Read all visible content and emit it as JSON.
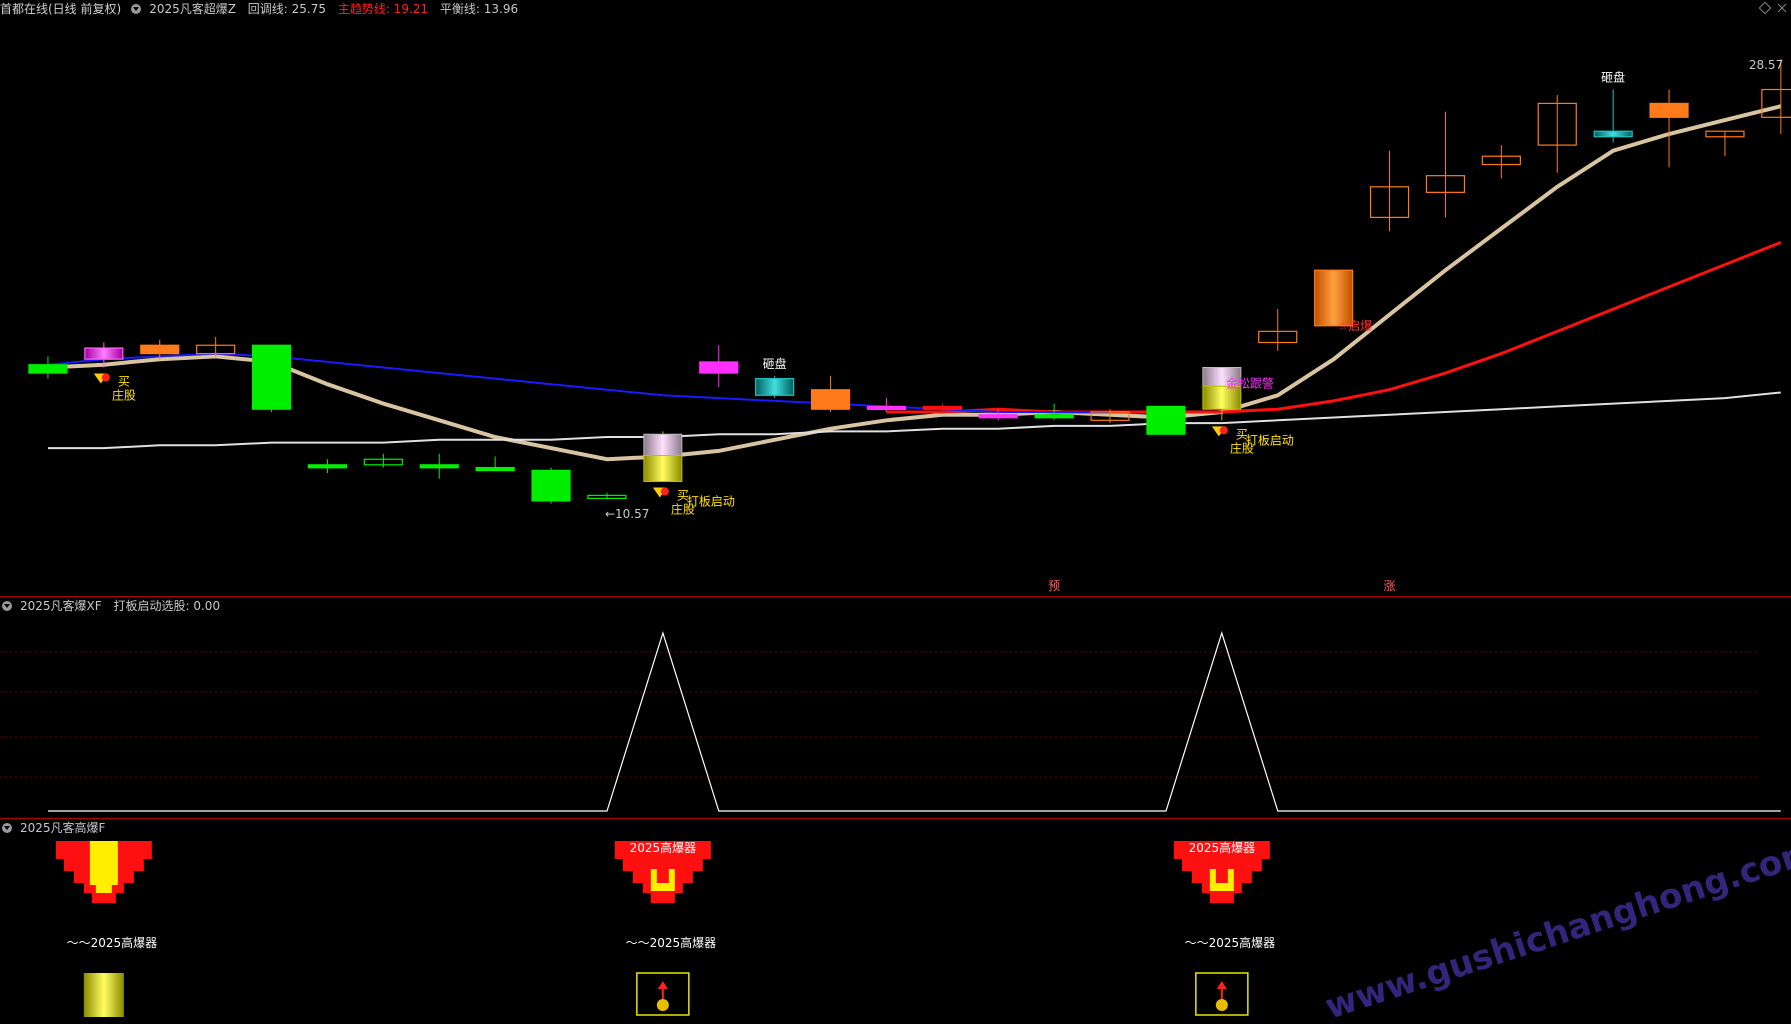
{
  "header": {
    "app_title": "首都在线(日线 前复权)",
    "indicator_name": "2025凡客超爆Z",
    "items": [
      {
        "label": "回调线: 25.75",
        "color": "#c8c8c8"
      },
      {
        "label": "主趋势线: 19.21",
        "color": "#ff2020"
      },
      {
        "label": "平衡线: 13.96",
        "color": "#c8c8c8"
      }
    ]
  },
  "panel2": {
    "title": "2025凡客爆XF",
    "value_label": "打板启动选股: 0.00"
  },
  "panel3": {
    "title": "2025凡客高爆F"
  },
  "watermark": "www.gushichanghong.com",
  "colors": {
    "bg": "#000000",
    "border": "#b00000",
    "up": "#ff7a1a",
    "down": "#00ee00",
    "beige": "#d8c4a0",
    "red": "#ff1010",
    "blue": "#1a1aff",
    "white": "#e0e0e0",
    "magenta": "#ff30ff",
    "yellow": "#e6e600"
  },
  "chart_data": [
    {
      "type": "candlestick",
      "title": "首都在线(日线 前复权)",
      "ylim": [
        10,
        30
      ],
      "candles": [
        {
          "o": 17.3,
          "h": 17.9,
          "l": 17.1,
          "c": 17.6,
          "style": "green"
        },
        {
          "o": 17.8,
          "h": 18.4,
          "l": 17.5,
          "c": 18.2,
          "style": "gradient-magenta"
        },
        {
          "o": 18.0,
          "h": 18.5,
          "l": 17.8,
          "c": 18.3,
          "style": "orange"
        },
        {
          "o": 18.3,
          "h": 18.6,
          "l": 17.9,
          "c": 18.0,
          "style": "hollow-orange"
        },
        {
          "o": 18.3,
          "h": 18.3,
          "l": 15.9,
          "c": 16.0,
          "style": "green"
        },
        {
          "o": 14.0,
          "h": 14.2,
          "l": 13.7,
          "c": 13.9,
          "style": "green"
        },
        {
          "o": 14.2,
          "h": 14.4,
          "l": 13.9,
          "c": 14.0,
          "style": "hollow-green"
        },
        {
          "o": 14.0,
          "h": 14.4,
          "l": 13.5,
          "c": 13.9,
          "style": "green"
        },
        {
          "o": 13.9,
          "h": 14.3,
          "l": 13.8,
          "c": 13.9,
          "style": "green"
        },
        {
          "o": 13.8,
          "h": 13.9,
          "l": 12.6,
          "c": 12.7,
          "style": "green"
        },
        {
          "o": 12.9,
          "h": 13.0,
          "l": 12.8,
          "c": 12.8,
          "style": "hollow-green"
        },
        {
          "o": 13.4,
          "h": 15.2,
          "l": 13.4,
          "c": 15.1,
          "style": "yellow-pillar"
        },
        {
          "o": 17.3,
          "h": 18.3,
          "l": 16.8,
          "c": 17.7,
          "style": "magenta"
        },
        {
          "o": 16.5,
          "h": 17.2,
          "l": 16.4,
          "c": 17.1,
          "style": "teal"
        },
        {
          "o": 16.0,
          "h": 17.2,
          "l": 15.9,
          "c": 16.7,
          "style": "orange"
        },
        {
          "o": 16.1,
          "h": 16.4,
          "l": 15.9,
          "c": 16.0,
          "style": "magenta"
        },
        {
          "o": 16.0,
          "h": 16.2,
          "l": 15.9,
          "c": 16.1,
          "style": "red"
        },
        {
          "o": 15.8,
          "h": 16.0,
          "l": 15.6,
          "c": 15.7,
          "style": "magenta"
        },
        {
          "o": 15.8,
          "h": 16.2,
          "l": 15.6,
          "c": 15.7,
          "style": "green"
        },
        {
          "o": 15.6,
          "h": 16.0,
          "l": 15.5,
          "c": 15.9,
          "style": "hollow-orange"
        },
        {
          "o": 16.1,
          "h": 16.1,
          "l": 15.1,
          "c": 15.1,
          "style": "green"
        },
        {
          "o": 16.0,
          "h": 17.5,
          "l": 15.6,
          "c": 17.5,
          "style": "yellow-pillar"
        },
        {
          "o": 18.8,
          "h": 19.6,
          "l": 18.1,
          "c": 18.4,
          "style": "hollow-orange"
        },
        {
          "o": 19.0,
          "h": 19.0,
          "l": 21.0,
          "c": 21.0,
          "style": "gradient-orange"
        },
        {
          "o": 22.9,
          "h": 25.3,
          "l": 22.4,
          "c": 24.0,
          "style": "hollow-orange"
        },
        {
          "o": 23.8,
          "h": 26.7,
          "l": 22.9,
          "c": 24.4,
          "style": "hollow-orange"
        },
        {
          "o": 24.8,
          "h": 25.5,
          "l": 24.3,
          "c": 25.1,
          "style": "hollow-orange"
        },
        {
          "o": 25.5,
          "h": 27.3,
          "l": 24.5,
          "c": 27.0,
          "style": "hollow-orange"
        },
        {
          "o": 26.0,
          "h": 27.5,
          "l": 25.6,
          "c": 25.8,
          "style": "teal"
        },
        {
          "o": 26.5,
          "h": 27.5,
          "l": 24.7,
          "c": 27.0,
          "style": "orange"
        },
        {
          "o": 26.0,
          "h": 26.0,
          "l": 25.1,
          "c": 25.8,
          "style": "hollow-orange"
        },
        {
          "o": 26.5,
          "h": 28.6,
          "l": 25.9,
          "c": 27.5,
          "style": "hollow-orange"
        }
      ],
      "lines": [
        {
          "name": "回调线",
          "color": "#d8c4a0",
          "values": [
            17.5,
            17.6,
            17.8,
            17.9,
            17.7,
            16.9,
            16.2,
            15.6,
            15.0,
            14.6,
            14.2,
            14.3,
            14.5,
            14.9,
            15.3,
            15.6,
            15.8,
            15.8,
            15.9,
            15.8,
            15.7,
            15.9,
            16.5,
            17.8,
            19.4,
            21.0,
            22.5,
            24.0,
            25.3,
            25.9,
            26.4,
            26.9
          ]
        },
        {
          "name": "主趋势线",
          "color": "#ff1010",
          "values": [
            null,
            null,
            null,
            null,
            null,
            null,
            null,
            null,
            null,
            null,
            null,
            null,
            null,
            null,
            null,
            15.9,
            15.9,
            16.0,
            15.9,
            15.9,
            15.9,
            15.9,
            16.0,
            16.3,
            16.7,
            17.3,
            18.0,
            18.8,
            19.6,
            20.4,
            21.2,
            22.0
          ]
        },
        {
          "name": "平衡线",
          "color": "#e0e0e0",
          "values": [
            14.6,
            14.6,
            14.7,
            14.7,
            14.8,
            14.8,
            14.8,
            14.9,
            14.9,
            14.9,
            15.0,
            15.0,
            15.1,
            15.1,
            15.2,
            15.2,
            15.3,
            15.3,
            15.4,
            15.4,
            15.5,
            15.5,
            15.6,
            15.7,
            15.8,
            15.9,
            16.0,
            16.1,
            16.2,
            16.3,
            16.4,
            16.6
          ]
        },
        {
          "name": "blue",
          "color": "#1a1aff",
          "values": [
            17.6,
            17.8,
            17.9,
            18.0,
            17.9,
            17.7,
            17.5,
            17.3,
            17.1,
            16.9,
            16.7,
            16.5,
            16.4,
            16.3,
            16.2,
            16.1,
            16.0,
            15.9,
            15.9,
            15.9
          ]
        }
      ],
      "annotations": [
        {
          "text": "砸盘",
          "color": "#ffffff",
          "bar": 13
        },
        {
          "text": "砸盘",
          "color": "#ffffff",
          "bar": 28
        },
        {
          "text": "☆启爆",
          "color": "#ff3030",
          "bar": 23
        },
        {
          "text": "金松跟警",
          "color": "#ff30ff",
          "bar": 21
        },
        {
          "text": "买",
          "color": "#ffe000",
          "bar": 1
        },
        {
          "text": "庄股",
          "color": "#ffe000",
          "bar": 1
        },
        {
          "text": "买",
          "color": "#ffe000",
          "bar": 11
        },
        {
          "text": "打板启动",
          "color": "#ffe000",
          "bar": 11
        },
        {
          "text": "庄股",
          "color": "#ffe000",
          "bar": 11
        },
        {
          "text": "买",
          "color": "#ffe000",
          "bar": 21
        },
        {
          "text": "打板启动",
          "color": "#ffe000",
          "bar": 21
        },
        {
          "text": "庄股",
          "color": "#ffe000",
          "bar": 21
        },
        {
          "text": "←10.57",
          "color": "#c8c8c8",
          "bar": 10
        },
        {
          "text": "28.57",
          "color": "#c8c8c8",
          "bar": 31
        },
        {
          "text": "预",
          "color": "#ff6060",
          "bar": 18
        },
        {
          "text": "涨",
          "color": "#ff6060",
          "bar": 24
        }
      ]
    },
    {
      "type": "line",
      "title": "2025凡客爆XF",
      "series": [
        {
          "name": "打板启动选股",
          "values": [
            0,
            0,
            0,
            0,
            0,
            0,
            0,
            0,
            0,
            0,
            0,
            1,
            0,
            0,
            0,
            0,
            0,
            0,
            0,
            0,
            0,
            1,
            0,
            0,
            0,
            0,
            0,
            0,
            0,
            0,
            0,
            0
          ]
        }
      ],
      "ylim": [
        0,
        1
      ]
    },
    {
      "type": "other",
      "title": "2025凡客高爆F",
      "signals": [
        {
          "bar": 1,
          "label": "～～2025高爆器",
          "top_label": ""
        },
        {
          "bar": 11,
          "label": "～～2025高爆器",
          "top_label": "2025高爆器"
        },
        {
          "bar": 21,
          "label": "～～2025高爆器",
          "top_label": "2025高爆器"
        }
      ]
    }
  ]
}
